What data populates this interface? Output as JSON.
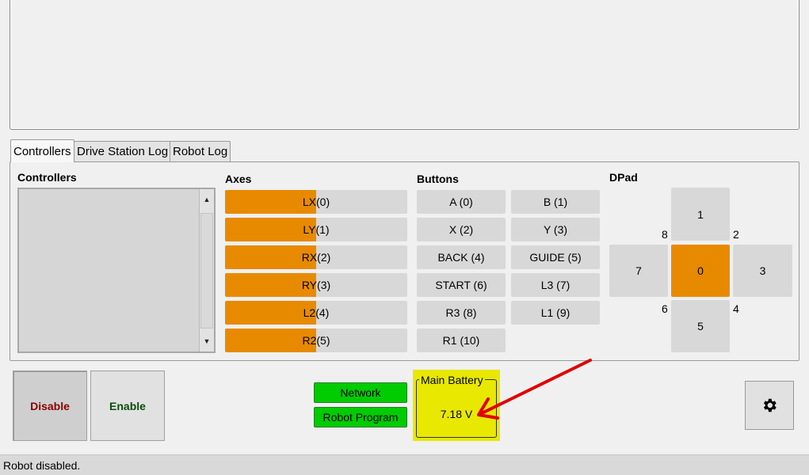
{
  "tabs": [
    {
      "label": "Controllers",
      "active": true
    },
    {
      "label": "Drive Station Log",
      "active": false
    },
    {
      "label": "Robot Log",
      "active": false
    }
  ],
  "sections": {
    "controllers": "Controllers",
    "axes": "Axes",
    "buttons": "Buttons",
    "dpad": "DPad"
  },
  "axes": [
    {
      "name": "LX",
      "index": "(0)",
      "fill_fraction": 0.5
    },
    {
      "name": "LY",
      "index": "(1)",
      "fill_fraction": 0.5
    },
    {
      "name": "RX",
      "index": "(2)",
      "fill_fraction": 0.5
    },
    {
      "name": "RY",
      "index": "(3)",
      "fill_fraction": 0.5
    },
    {
      "name": "L2",
      "index": "(4)",
      "fill_fraction": 0.5
    },
    {
      "name": "R2",
      "index": "(5)",
      "fill_fraction": 0.5
    }
  ],
  "buttons": [
    "A (0)",
    "B (1)",
    "X (2)",
    "Y (3)",
    "BACK (4)",
    "GUIDE (5)",
    "START (6)",
    "L3 (7)",
    "R3 (8)",
    "L1 (9)",
    "R1 (10)"
  ],
  "dpad": {
    "up": "1",
    "left": "7",
    "center": "0",
    "right": "3",
    "down": "5",
    "corners": {
      "up_left": "8",
      "up_right": "2",
      "down_left": "6",
      "down_right": "4"
    },
    "active": "0"
  },
  "controls": {
    "disable": "Disable",
    "enable": "Enable"
  },
  "status": {
    "network": "Network",
    "robot_program": "Robot Program"
  },
  "battery": {
    "title": "Main Battery",
    "value": "7.18 V"
  },
  "status_bar": "Robot disabled.",
  "colors": {
    "accent_orange": "#e88a00",
    "status_green": "#00cc00",
    "battery_yellow": "#e8e800",
    "disable_text": "#8b0000",
    "enable_text": "#0b4d0b",
    "annotation_arrow": "#e00000"
  },
  "icons": {
    "settings": "gear-icon",
    "scroll_up": "triangle-up-icon",
    "scroll_down": "triangle-down-icon"
  }
}
